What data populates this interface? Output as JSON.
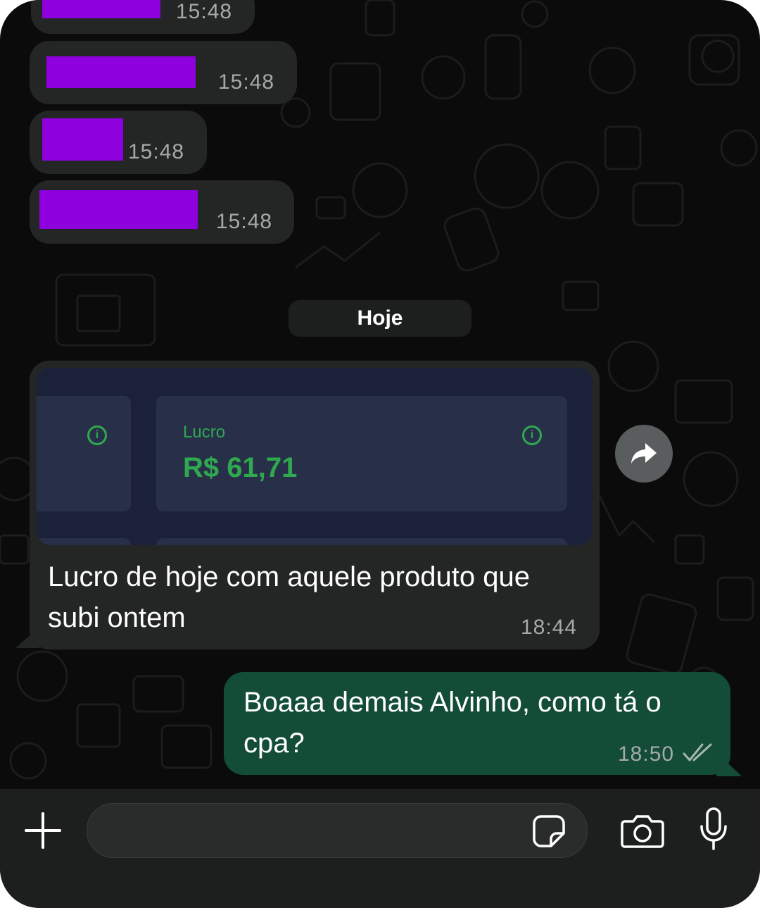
{
  "conversation": {
    "earlier_messages": [
      {
        "time": "15:48"
      },
      {
        "time": "15:48"
      },
      {
        "time": "15:48"
      },
      {
        "time": "15:48"
      }
    ],
    "date_separator": "Hoje",
    "image_message": {
      "screenshot": {
        "card_label": "Lucro",
        "card_value": "R$ 61,71"
      },
      "caption": "Lucro de hoje com aquele produto que subi ontem",
      "time": "18:44"
    },
    "outgoing_message": {
      "text": "Boaaa demais Alvinho, como tá o cpa?",
      "time": "18:50",
      "status": "read"
    }
  },
  "composer": {
    "attach_icon": "plus-icon",
    "sticker_icon": "sticker-icon",
    "camera_icon": "camera-icon",
    "mic_icon": "microphone-icon"
  },
  "colors": {
    "background": "#0b0b0b",
    "incoming_bubble": "#242626",
    "outgoing_bubble": "#134d37",
    "redaction": "#8e00de",
    "profit_green": "#2fa84f"
  }
}
